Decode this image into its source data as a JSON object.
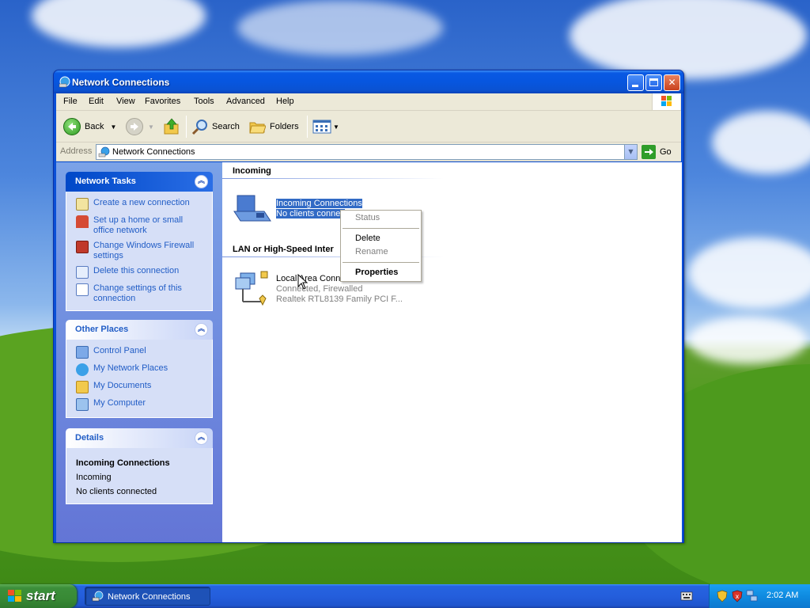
{
  "window": {
    "title": "Network Connections"
  },
  "menu": [
    "File",
    "Edit",
    "View",
    "Favorites",
    "Tools",
    "Advanced",
    "Help"
  ],
  "toolbar": {
    "back": "Back",
    "search": "Search",
    "folders": "Folders"
  },
  "address": {
    "label": "Address",
    "value": "Network Connections",
    "go": "Go"
  },
  "network_tasks": {
    "title": "Network Tasks",
    "items": [
      "Create a new connection",
      "Set up a home or small office network",
      "Change Windows Firewall settings",
      "Delete this connection",
      "Change settings of this connection"
    ]
  },
  "other_places": {
    "title": "Other Places",
    "items": [
      "Control Panel",
      "My Network Places",
      "My Documents",
      "My Computer"
    ]
  },
  "details": {
    "title": "Details",
    "name": "Incoming Connections",
    "type": "Incoming",
    "status": "No clients connected"
  },
  "groups": {
    "incoming": {
      "title": "Incoming",
      "item": {
        "name": "Incoming Connections",
        "status": "No clients connec"
      }
    },
    "lan": {
      "title": "LAN or High-Speed Inter",
      "item": {
        "name": "Local Area Conne",
        "status": "Connected, Firewalled",
        "device": "Realtek RTL8139 Family PCI F..."
      }
    }
  },
  "context_menu": {
    "items": [
      "Status",
      "Delete",
      "Rename",
      "Properties"
    ]
  },
  "taskbar": {
    "start": "start",
    "task": "Network Connections",
    "clock": "2:02 AM"
  },
  "colors": {
    "selection": "#316ac5",
    "link": "#215dc6",
    "title_bar": "#0756df"
  }
}
